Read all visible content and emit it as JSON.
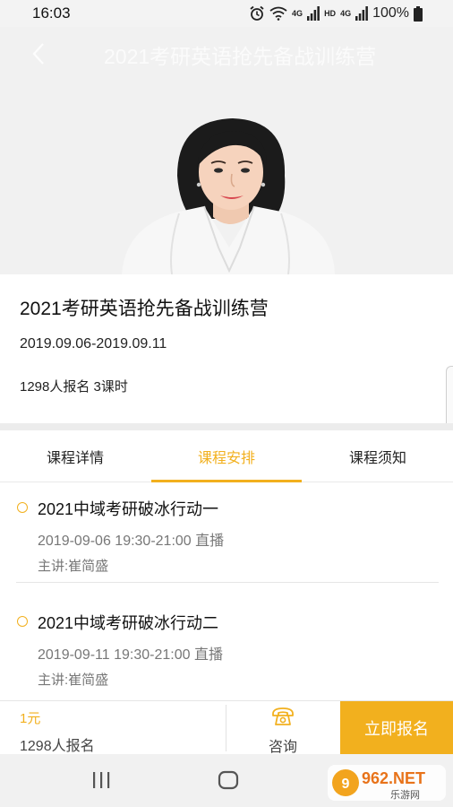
{
  "status_bar": {
    "time": "16:03",
    "network_label": "4G",
    "hd_label": "HD",
    "network_label_2": "4G",
    "battery": "100%"
  },
  "header": {
    "back_icon": "chevron-left-icon",
    "title": "2021考研英语抢先备战训练营"
  },
  "course": {
    "title": "2021考研英语抢先备战训练营",
    "dates": "2019.09.06-2019.09.11",
    "meta": "1298人报名 3课时"
  },
  "tabs": [
    {
      "label": "课程详情",
      "active": false
    },
    {
      "label": "课程安排",
      "active": true
    },
    {
      "label": "课程须知",
      "active": false
    }
  ],
  "schedule": [
    {
      "name": "2021中域考研破冰行动一",
      "time": "2019-09-06 19:30-21:00  直播",
      "teacher": "主讲:崔简盛"
    },
    {
      "name": "2021中域考研破冰行动二",
      "time": "2019-09-11 19:30-21:00  直播",
      "teacher": "主讲:崔简盛"
    }
  ],
  "bottom_bar": {
    "price": "1元",
    "enroll_count": "1298人报名",
    "consult_label": "咨询",
    "consult_icon": "phone-icon",
    "signup_label": "立即报名"
  },
  "watermark": {
    "brand": "962.NET",
    "sub": "乐游网"
  },
  "colors": {
    "accent": "#f2b01e",
    "text_primary": "#111111",
    "text_secondary": "#777777"
  }
}
